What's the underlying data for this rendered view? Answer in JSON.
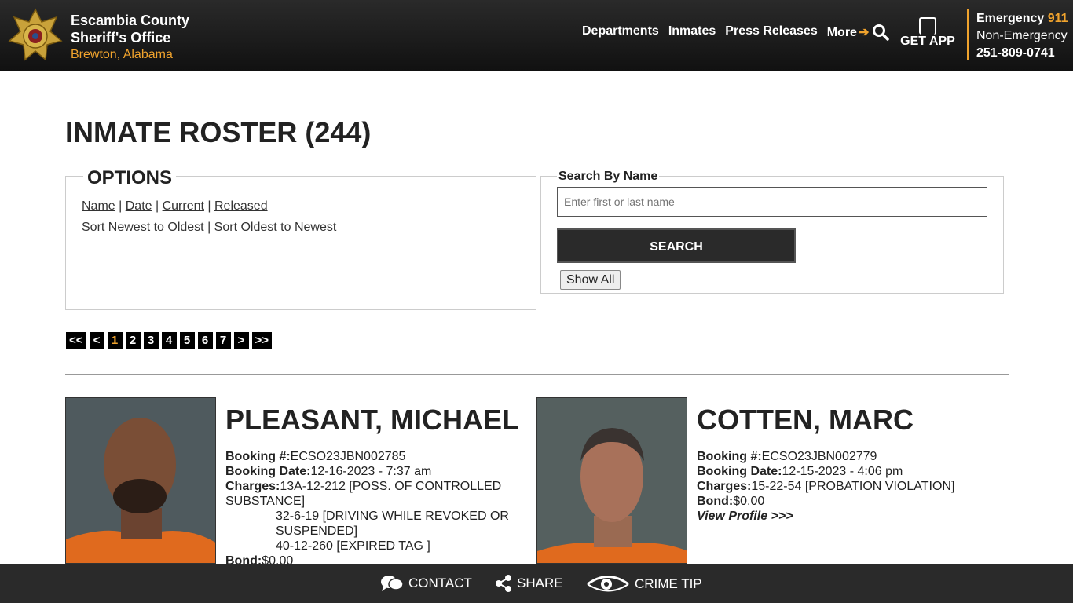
{
  "header": {
    "org_line1": "Escambia County",
    "org_line2": "Sheriff's Office",
    "org_location": "Brewton, Alabama",
    "nav": [
      "Departments",
      "Inmates",
      "Press Releases",
      "More"
    ],
    "get_app": "GET APP",
    "emergency_label": "Emergency",
    "emergency_number": "911",
    "non_emergency_label": "Non-Emergency",
    "non_emergency_number": "251-809-0741",
    "accent": "#f0a32d"
  },
  "page": {
    "title": "INMATE ROSTER (244)"
  },
  "options": {
    "legend": "OPTIONS",
    "filters": [
      "Name",
      "Date",
      "Current",
      "Released"
    ],
    "sorts": [
      "Sort Newest to Oldest",
      "Sort Oldest to Newest"
    ]
  },
  "search": {
    "label": "Search By Name",
    "placeholder": "Enter first or last name",
    "button": "SEARCH",
    "show_all": "Show All"
  },
  "pager": {
    "first": "<<",
    "prev": "<",
    "pages": [
      "1",
      "2",
      "3",
      "4",
      "5",
      "6",
      "7"
    ],
    "current": "1",
    "next": ">",
    "last": ">>"
  },
  "inmates": [
    {
      "name": "PLEASANT, MICHAEL",
      "booking_label": "Booking #:",
      "booking_no": "ECSO23JBN002785",
      "date_label": "Booking Date:",
      "date": "12-16-2023 - 7:37 am",
      "charges_label": "Charges:",
      "charges": [
        "13A-12-212 [POSS. OF CONTROLLED SUBSTANCE]",
        "32-6-19 [DRIVING WHILE REVOKED OR SUSPENDED]",
        "40-12-260 [EXPIRED TAG ]"
      ],
      "bond_label": "Bond:",
      "bond": "$0.00"
    },
    {
      "name": "COTTEN, MARC",
      "booking_label": "Booking #:",
      "booking_no": "ECSO23JBN002779",
      "date_label": "Booking Date:",
      "date": "12-15-2023 - 4:06 pm",
      "charges_label": "Charges:",
      "charges": [
        "15-22-54 [PROBATION VIOLATION]"
      ],
      "bond_label": "Bond:",
      "bond": "$0.00",
      "view": "View Profile >>>"
    }
  ],
  "footer": {
    "contact": "CONTACT",
    "share": "SHARE",
    "crime_tip": "CRIME TIP"
  }
}
